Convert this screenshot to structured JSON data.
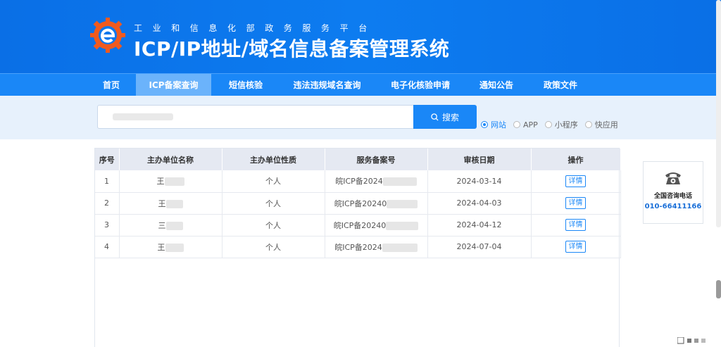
{
  "header": {
    "subtitle": "工业和信息化部政务服务平台",
    "title": "ICP/IP地址/域名信息备案管理系统"
  },
  "nav": [
    {
      "label": "首页"
    },
    {
      "label": "ICP备案查询"
    },
    {
      "label": "短信核验"
    },
    {
      "label": "违法违规域名查询"
    },
    {
      "label": "电子化核验申请"
    },
    {
      "label": "通知公告"
    },
    {
      "label": "政策文件"
    }
  ],
  "search": {
    "value": "",
    "button_label": "搜索",
    "types": [
      {
        "label": "网站",
        "checked": true
      },
      {
        "label": "APP",
        "checked": false
      },
      {
        "label": "小程序",
        "checked": false
      },
      {
        "label": "快应用",
        "checked": false
      }
    ]
  },
  "table": {
    "headers": [
      "序号",
      "主办单位名称",
      "主办单位性质",
      "服务备案号",
      "审核日期",
      "操作"
    ],
    "rows": [
      {
        "no": "1",
        "name": "王",
        "type": "个人",
        "record": "皖ICP备2024",
        "date": "2024-03-14",
        "action": "详情"
      },
      {
        "no": "2",
        "name": "王",
        "type": "个人",
        "record": "皖ICP备20240",
        "date": "2024-04-03",
        "action": "详情"
      },
      {
        "no": "3",
        "name": "三",
        "type": "个人",
        "record": "皖ICP备20240",
        "date": "2024-04-12",
        "action": "详情"
      },
      {
        "no": "4",
        "name": "王",
        "type": "个人",
        "record": "皖ICP备2024",
        "date": "2024-07-04",
        "action": "详情"
      }
    ]
  },
  "contact": {
    "label": "全国咨询电话",
    "phone": "010-66411166",
    "icon": "telephone-icon"
  },
  "colors": {
    "primary": "#1a87f7",
    "header": "#0a6fe6",
    "nav_active": "#6bb3fb",
    "search_band": "#e7f1fc",
    "logo_orange": "#f05a1e"
  }
}
